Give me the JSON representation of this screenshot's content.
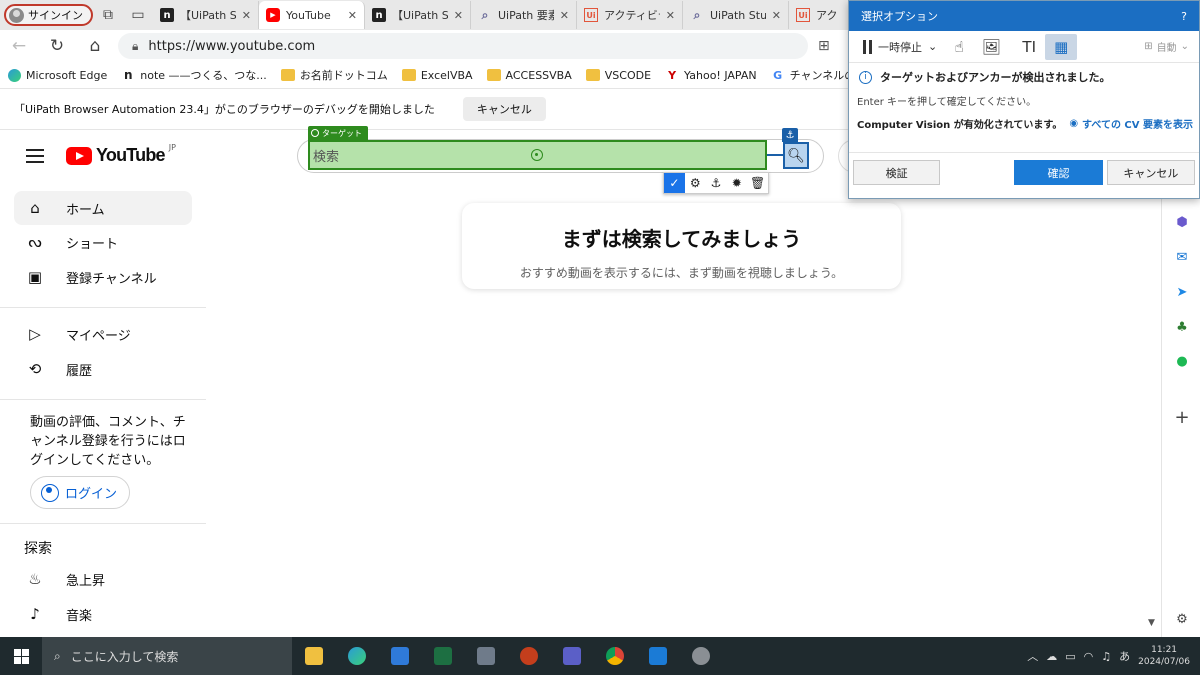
{
  "browser": {
    "signin_label": "サインイン",
    "tabs": [
      {
        "title": "【UiPath Stu",
        "favicon": "n",
        "active": false
      },
      {
        "title": "YouTube",
        "favicon": "yt",
        "active": true
      },
      {
        "title": "【UiPath Stu",
        "favicon": "n",
        "active": false
      },
      {
        "title": "UiPath 要素",
        "favicon": "mag",
        "active": false
      },
      {
        "title": "アクティビテ",
        "favicon": "ui",
        "active": false
      },
      {
        "title": "UiPath Stu",
        "favicon": "mag",
        "active": false
      },
      {
        "title": "アク",
        "favicon": "ui",
        "active": false
      }
    ],
    "url": "https://www.youtube.com",
    "bookmarks": [
      {
        "label": "Microsoft Edge",
        "icon": "edge"
      },
      {
        "label": "note ——つくる、つな...",
        "icon": "n"
      },
      {
        "label": "お名前ドットコム",
        "icon": "folder"
      },
      {
        "label": "ExcelVBA",
        "icon": "folder"
      },
      {
        "label": "ACCESSVBA",
        "icon": "folder"
      },
      {
        "label": "VSCODE",
        "icon": "folder"
      },
      {
        "label": "Yahoo! JAPAN",
        "icon": "y"
      },
      {
        "label": "チャンネルのダッシュボ...",
        "icon": "g"
      }
    ],
    "debug_message": "「UiPath Browser Automation 23.4」がこのブラウザーのデバッグを開始しました",
    "debug_cancel": "キャンセル"
  },
  "youtube": {
    "logo_text": "YouTube",
    "logo_region": "JP",
    "nav": [
      {
        "label": "ホーム",
        "icon": "home-icon",
        "active": true
      },
      {
        "label": "ショート",
        "icon": "shorts-icon",
        "active": false
      },
      {
        "label": "登録チャンネル",
        "icon": "subscriptions-icon",
        "active": false
      }
    ],
    "nav2": [
      {
        "label": "マイページ",
        "icon": "my-page-icon"
      },
      {
        "label": "履歴",
        "icon": "history-icon"
      }
    ],
    "login_message": "動画の評価、コメント、チャンネル登録を行うにはログインしてください。",
    "login_button": "ログイン",
    "explore_heading": "探索",
    "explore": [
      {
        "label": "急上昇",
        "icon": "trending-icon"
      },
      {
        "label": "音楽",
        "icon": "music-icon"
      }
    ],
    "search_placeholder": "検索",
    "prompt_title": "まずは検索してみましょう",
    "prompt_subtitle": "おすすめ動画を表示するには、まず動画を視聴しましょう。"
  },
  "uipath_overlay": {
    "target_label": "ターゲット",
    "dialog": {
      "title": "選択オプション",
      "help": "?",
      "pause_label": "一時停止",
      "auto_label": "自動",
      "info_text": "ターゲットおよびアンカーが検出されました。",
      "sub_text": "Enter キーを押して確定してください。",
      "cv_label": "Computer Vision が有効化されています。",
      "cv_link": "すべての CV 要素を表示",
      "verify_button": "検証",
      "confirm_button": "確認",
      "cancel_button": "キャンセル"
    }
  },
  "taskbar": {
    "search_placeholder": "ここに入力して検索",
    "time": "11:21",
    "date": "2024/07/06",
    "ime": "あ"
  },
  "colors": {
    "youtube_red": "#ff0000",
    "uipath_target_green": "#2e8b1e",
    "uipath_anchor_blue": "#1a5fa8",
    "dialog_primary": "#1b7bd6"
  }
}
